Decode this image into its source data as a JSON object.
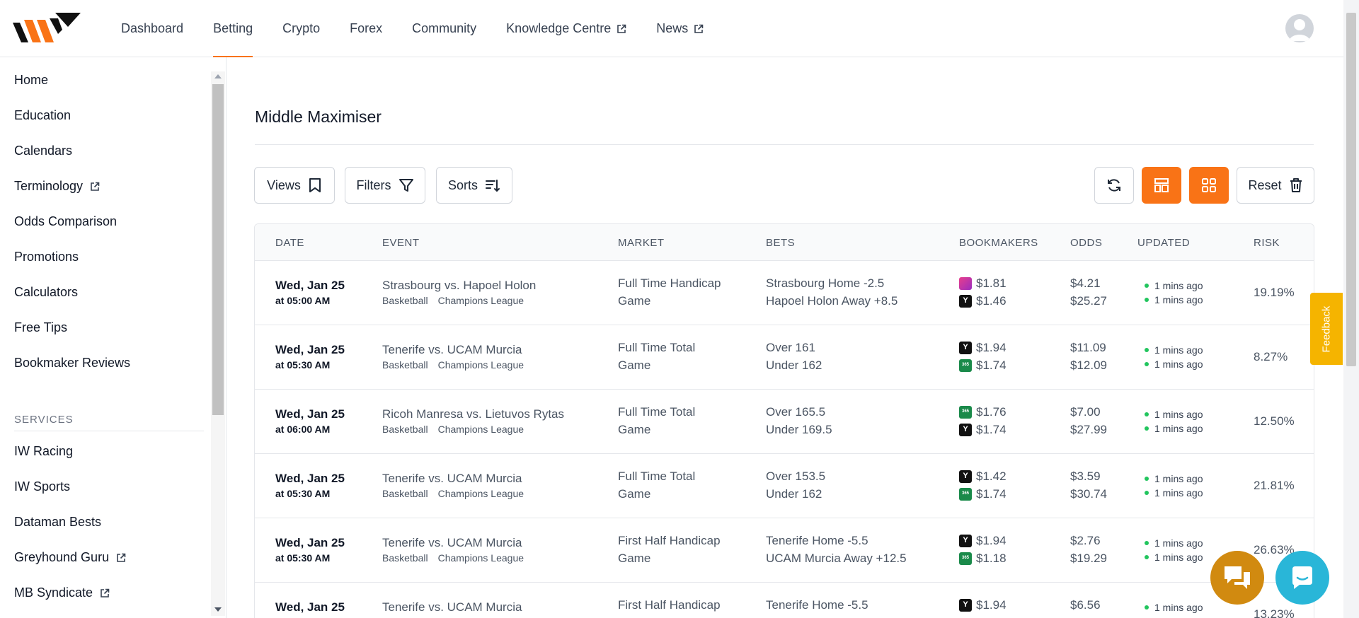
{
  "topnav": {
    "items": [
      {
        "label": "Dashboard",
        "external": false
      },
      {
        "label": "Betting",
        "external": false
      },
      {
        "label": "Crypto",
        "external": false
      },
      {
        "label": "Forex",
        "external": false
      },
      {
        "label": "Community",
        "external": false
      },
      {
        "label": "Knowledge Centre",
        "external": true
      },
      {
        "label": "News",
        "external": true
      }
    ],
    "active": "Betting"
  },
  "sidebar": {
    "items": [
      {
        "label": "Home"
      },
      {
        "label": "Education"
      },
      {
        "label": "Calendars"
      },
      {
        "label": "Terminology",
        "external": true
      },
      {
        "label": "Odds Comparison"
      },
      {
        "label": "Promotions"
      },
      {
        "label": "Calculators"
      },
      {
        "label": "Free Tips"
      },
      {
        "label": "Bookmaker Reviews"
      }
    ],
    "section_title": "SERVICES",
    "services": [
      {
        "label": "IW Racing"
      },
      {
        "label": "IW Sports"
      },
      {
        "label": "Dataman Bests"
      },
      {
        "label": "Greyhound Guru",
        "external": true
      },
      {
        "label": "MB Syndicate",
        "external": true
      }
    ]
  },
  "main": {
    "title": "Middle Maximiser",
    "toolbar": {
      "views": "Views",
      "filters": "Filters",
      "sorts": "Sorts",
      "reset": "Reset"
    },
    "columns": [
      "DATE",
      "EVENT",
      "MARKET",
      "BETS",
      "BOOKMAKERS",
      "ODDS",
      "UPDATED",
      "RISK"
    ],
    "rows": [
      {
        "date": "Wed, Jan 25",
        "time": "at 05:00 AM",
        "event": "Strasbourg vs. Hapoel Holon",
        "sport": "Basketball",
        "league": "Champions League",
        "market1": "Full Time Handicap",
        "market2": "Game",
        "bet1": "Strasbourg Home -2.5",
        "bet2": "Hapoel Holon Away +8.5",
        "bk1": {
          "icon": "pink",
          "price": "$1.81"
        },
        "bk2": {
          "icon": "black",
          "price": "$1.46"
        },
        "odds1": "$4.21",
        "odds2": "$25.27",
        "upd1": "1 mins ago",
        "upd2": "1 mins ago",
        "risk": "19.19%"
      },
      {
        "date": "Wed, Jan 25",
        "time": "at 05:30 AM",
        "event": "Tenerife vs. UCAM Murcia",
        "sport": "Basketball",
        "league": "Champions League",
        "market1": "Full Time Total",
        "market2": "Game",
        "bet1": "Over 161",
        "bet2": "Under 162",
        "bk1": {
          "icon": "black",
          "price": "$1.94"
        },
        "bk2": {
          "icon": "green",
          "price": "$1.74"
        },
        "odds1": "$11.09",
        "odds2": "$12.09",
        "upd1": "1 mins ago",
        "upd2": "1 mins ago",
        "risk": "8.27%"
      },
      {
        "date": "Wed, Jan 25",
        "time": "at 06:00 AM",
        "event": "Ricoh Manresa vs. Lietuvos Rytas",
        "sport": "Basketball",
        "league": "Champions League",
        "market1": "Full Time Total",
        "market2": "Game",
        "bet1": "Over 165.5",
        "bet2": "Under 169.5",
        "bk1": {
          "icon": "green",
          "price": "$1.76"
        },
        "bk2": {
          "icon": "black",
          "price": "$1.74"
        },
        "odds1": "$7.00",
        "odds2": "$27.99",
        "upd1": "1 mins ago",
        "upd2": "1 mins ago",
        "risk": "12.50%"
      },
      {
        "date": "Wed, Jan 25",
        "time": "at 05:30 AM",
        "event": "Tenerife vs. UCAM Murcia",
        "sport": "Basketball",
        "league": "Champions League",
        "market1": "Full Time Total",
        "market2": "Game",
        "bet1": "Over 153.5",
        "bet2": "Under 162",
        "bk1": {
          "icon": "black",
          "price": "$1.42"
        },
        "bk2": {
          "icon": "green",
          "price": "$1.74"
        },
        "odds1": "$3.59",
        "odds2": "$30.74",
        "upd1": "1 mins ago",
        "upd2": "1 mins ago",
        "risk": "21.81%"
      },
      {
        "date": "Wed, Jan 25",
        "time": "at 05:30 AM",
        "event": "Tenerife vs. UCAM Murcia",
        "sport": "Basketball",
        "league": "Champions League",
        "market1": "First Half Handicap",
        "market2": "Game",
        "bet1": "Tenerife Home -5.5",
        "bet2": "UCAM Murcia Away +12.5",
        "bk1": {
          "icon": "black",
          "price": "$1.94"
        },
        "bk2": {
          "icon": "green",
          "price": "$1.18"
        },
        "odds1": "$2.76",
        "odds2": "$19.29",
        "upd1": "1 mins ago",
        "upd2": "1 mins ago",
        "risk": "26.63%"
      },
      {
        "date": "Wed, Jan 25",
        "time": "",
        "event": "Tenerife vs. UCAM Murcia",
        "sport": "",
        "league": "",
        "market1": "First Half Handicap",
        "market2": "",
        "bet1": "Tenerife Home -5.5",
        "bet2": "",
        "bk1": {
          "icon": "black",
          "price": "$1.94"
        },
        "bk2": {
          "icon": "",
          "price": ""
        },
        "odds1": "$6.56",
        "odds2": "",
        "upd1": "1 mins ago",
        "upd2": "",
        "risk": "13.23%"
      }
    ]
  },
  "feedback": "Feedback",
  "colors": {
    "accent": "#f97316",
    "feedback": "#f5b400",
    "chat1": "#d18a10",
    "chat2": "#29b6d8"
  }
}
